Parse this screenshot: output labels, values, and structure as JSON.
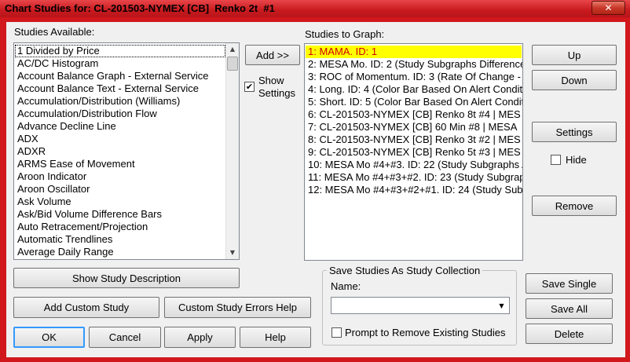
{
  "window": {
    "title": "Chart Studies for: CL-201503-NYMEX [CB]  Renko 2t  #1",
    "close_glyph": "✕"
  },
  "studies_available": {
    "label": "Studies Available:",
    "items": [
      "1 Divided by Price",
      "AC/DC Histogram",
      "Account Balance Graph - External Service",
      "Account Balance Text - External Service",
      "Accumulation/Distribution (Williams)",
      "Accumulation/Distribution Flow",
      "Advance Decline Line",
      "ADX",
      "ADXR",
      "ARMS Ease of Movement",
      "Aroon Indicator",
      "Aroon Oscillator",
      "Ask Volume",
      "Ask/Bid Volume Difference Bars",
      "Auto Retracement/Projection",
      "Automatic Trendlines",
      "Average Daily Range"
    ]
  },
  "add_button": {
    "label": "Add >>"
  },
  "show_settings": {
    "label_line1": "Show",
    "label_line2": "Settings",
    "checked_glyph": "✔"
  },
  "studies_to_graph": {
    "label": "Studies to Graph:",
    "items": [
      "1: MAMA. ID: 1",
      "2: MESA Mo. ID: 2 (Study Subgraphs Difference",
      "3: ROC of Momentum. ID: 3 (Rate Of Change - P",
      "4: Long. ID: 4 (Color Bar Based On Alert Condit",
      "5: Short. ID: 5 (Color Bar Based On Alert Conditi",
      "6: CL-201503-NYMEX [CB]  Renko 8t  #4 | MES",
      "7: CL-201503-NYMEX [CB]  60 Min   #8 | MESA",
      "8: CL-201503-NYMEX [CB]  Renko 3t  #2 | MES",
      "9: CL-201503-NYMEX [CB]  Renko 5t  #3 | MES",
      "10: MESA Mo #4+#3. ID: 22 (Study Subgraphs A",
      "11: MESA Mo #4+#3+#2. ID: 23 (Study Subgraph",
      "12: MESA Mo #4+#3+#2+#1. ID: 24 (Study Subg"
    ]
  },
  "right_buttons": {
    "up": "Up",
    "down": "Down",
    "settings": "Settings",
    "hide": "Hide",
    "remove": "Remove"
  },
  "bottom_left_buttons": {
    "show_description": "Show Study Description",
    "add_custom": "Add Custom Study",
    "custom_errors": "Custom Study Errors Help",
    "ok": "OK",
    "cancel": "Cancel",
    "apply": "Apply",
    "help": "Help"
  },
  "collection": {
    "group_title": "Save Studies As Study Collection",
    "name_label": "Name:",
    "name_value": "",
    "prompt_label": "Prompt to Remove Existing Studies",
    "save_single": "Save Single",
    "save_all": "Save All",
    "delete": "Delete"
  },
  "colors": {
    "title_bar": "#d1181c",
    "selected_item_bg": "#ffff00",
    "selected_item_text": "#d00000",
    "default_button_border": "#3399ff"
  }
}
